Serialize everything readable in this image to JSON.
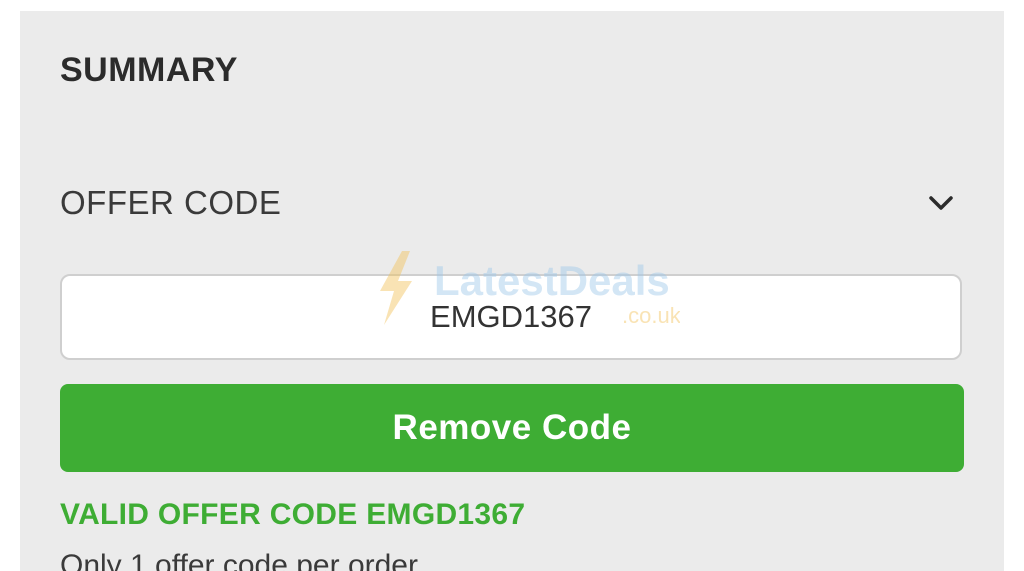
{
  "summary": {
    "title": "SUMMARY",
    "offer_code_label": "OFFER CODE",
    "code_value": "EMGD1367",
    "remove_button_label": "Remove Code",
    "valid_message": "VALID OFFER CODE EMGD1367",
    "note": "Only 1 offer code per order"
  },
  "watermark": {
    "brand": "LatestDeals",
    "domain": ".co.uk"
  },
  "colors": {
    "panel_bg": "#ebebeb",
    "accent_green": "#3ead34",
    "text_dark": "#2b2b2b"
  }
}
